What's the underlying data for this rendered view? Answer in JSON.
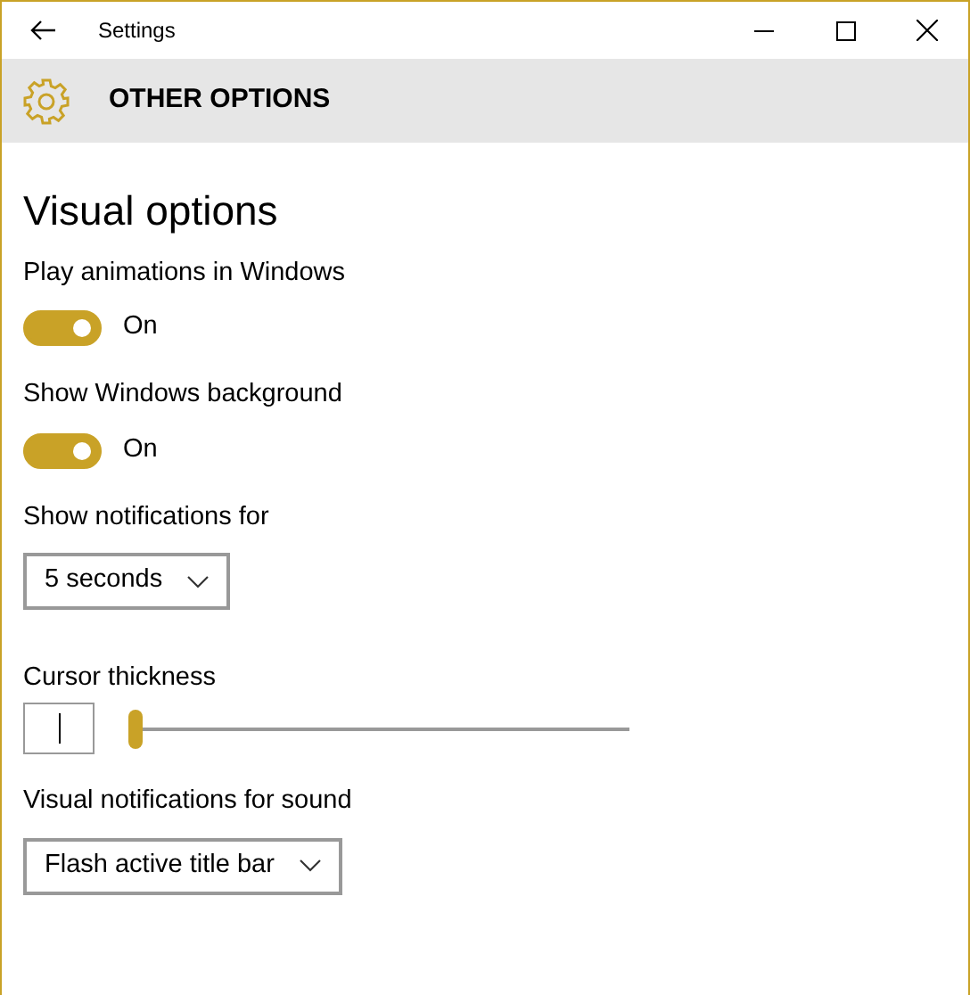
{
  "window": {
    "title": "Settings"
  },
  "header": {
    "title": "OTHER OPTIONS"
  },
  "section_title": "Visual options",
  "settings": [
    {
      "kind": "toggle",
      "label": "Play animations in Windows",
      "on": true,
      "state_text": "On"
    },
    {
      "kind": "toggle",
      "label": "Show Windows background",
      "on": true,
      "state_text": "On"
    },
    {
      "kind": "dropdown",
      "label": "Show notifications for",
      "value": "5 seconds"
    },
    {
      "kind": "slider",
      "label": "Cursor thickness",
      "level": 0
    },
    {
      "kind": "dropdown",
      "label": "Visual notifications for sound",
      "value": "Flash active title bar"
    }
  ]
}
